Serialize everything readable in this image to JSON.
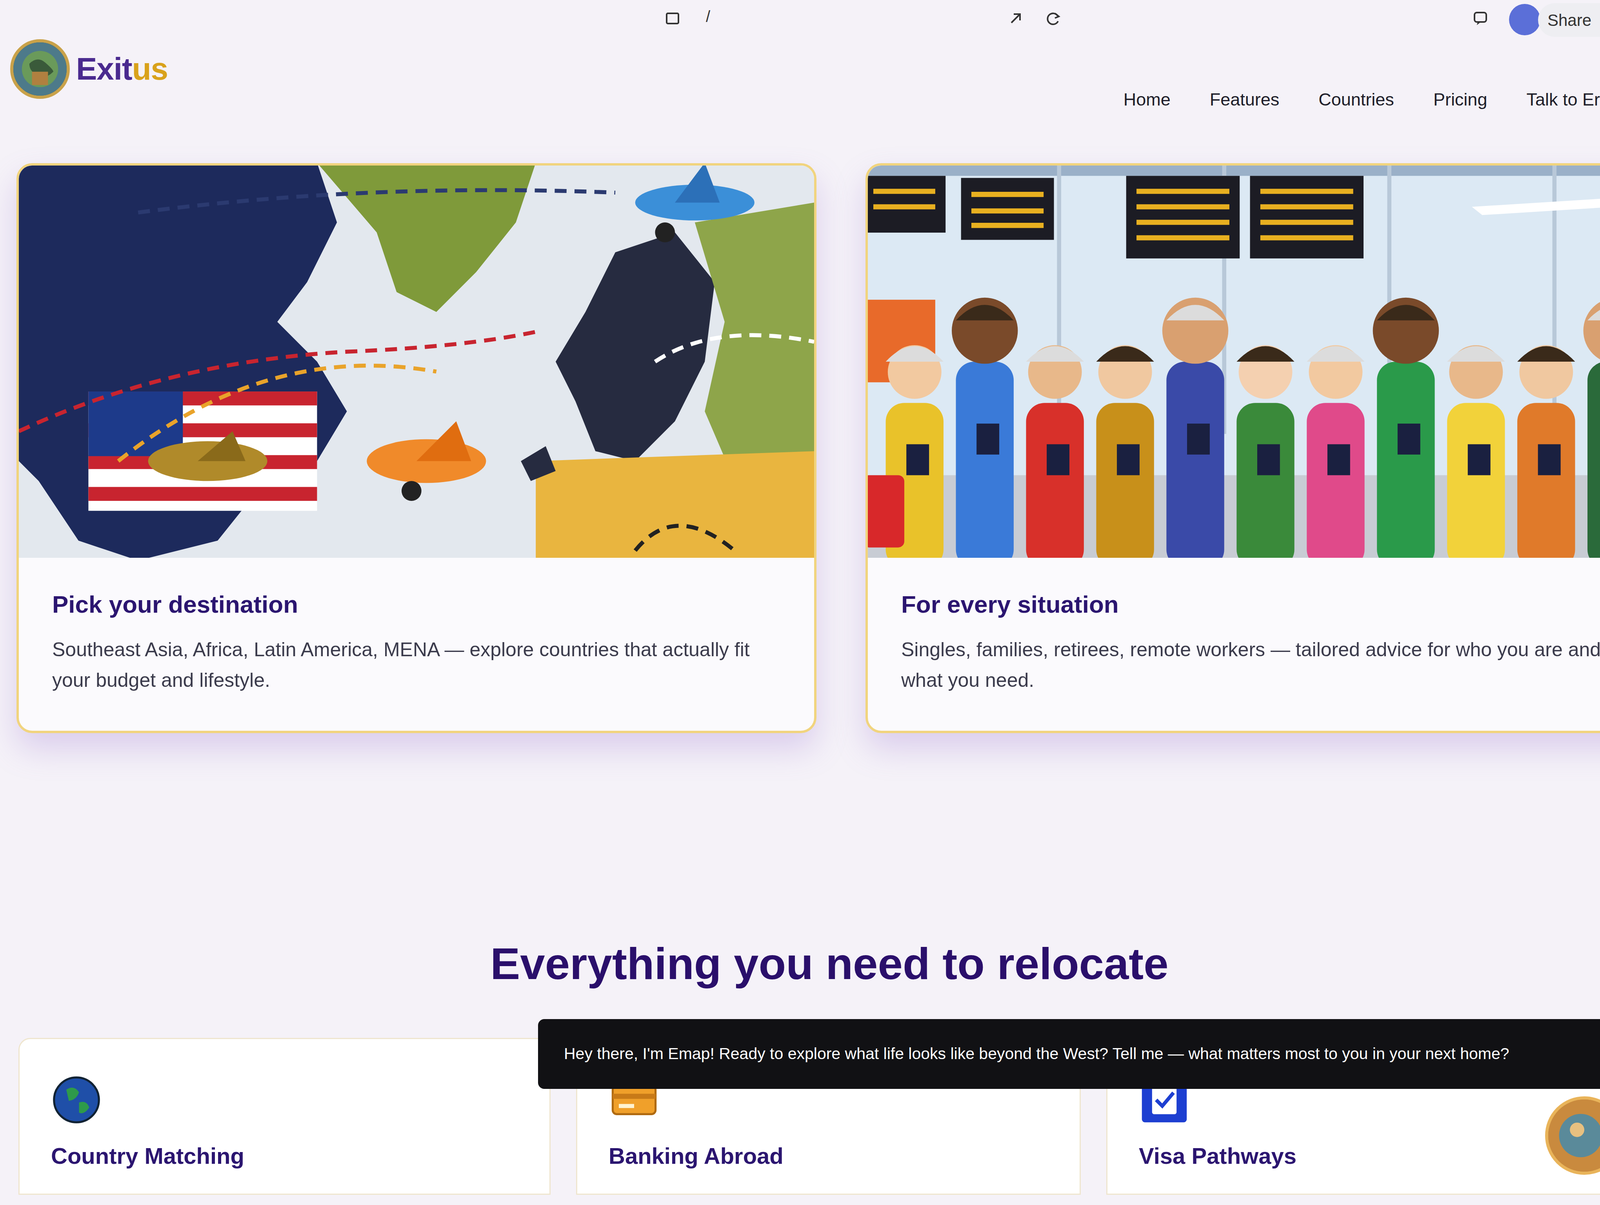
{
  "toolbar": {
    "separator": "/",
    "share": "Share"
  },
  "brand": {
    "part1": "Exit",
    "part2": "us"
  },
  "nav": [
    {
      "label": "Home"
    },
    {
      "label": "Features"
    },
    {
      "label": "Countries"
    },
    {
      "label": "Pricing"
    },
    {
      "label": "Talk to Er"
    }
  ],
  "hero_cards": [
    {
      "title": "Pick your destination",
      "text": "Southeast Asia, Africa, Latin America, MENA — explore countries that actually fit your budget and lifestyle."
    },
    {
      "title": "For every situation",
      "text": "Singles, families, retirees, remote workers — tailored advice for who you are and what you need."
    }
  ],
  "section": {
    "heading": "Everything you need to relocate"
  },
  "assistant": {
    "message": "Hey there, I'm Emap! Ready to explore what life looks like beyond the West? Tell me — what matters most to you in your next home?"
  },
  "features": [
    {
      "title": "Country Matching"
    },
    {
      "title": "Banking Abroad"
    },
    {
      "title": "Visa Pathways"
    }
  ]
}
